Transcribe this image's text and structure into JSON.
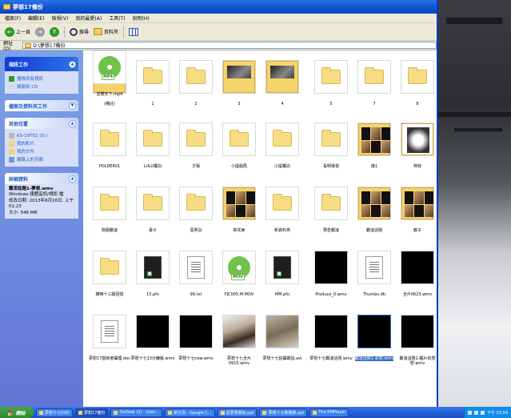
{
  "window": {
    "title": "夢想17備份",
    "menu": [
      "檔案(F)",
      "編輯(E)",
      "檢視(V)",
      "我的最愛(A)",
      "工具(T)",
      "說明(H)"
    ],
    "toolbar": {
      "back": "上一頁",
      "search": "搜尋",
      "folders": "資料夾"
    },
    "address_label": "網址(D)",
    "address_value": "D:\\夢想17備份"
  },
  "taskpane": {
    "video_tasks": {
      "title": "視訊工作",
      "items": [
        "播放所有視訊",
        "燒製到 CD"
      ]
    },
    "file_tasks": {
      "title": "檔案及資料夾工作"
    },
    "other_places": {
      "title": "其他位置",
      "items": [
        "KS-19T02 (D:)",
        "我的影片",
        "我的文件",
        "網路上的芳鄰"
      ]
    },
    "details": {
      "title": "詳細資料",
      "name": "霸凌話題1-夢想.wmv",
      "type": "Windows 媒體音訊/視訊 檔",
      "modified": "修改日期: 2013年8月16日, 上午 01:23",
      "size": "大小: 546 MB"
    }
  },
  "files": [
    {
      "label": "(備註)",
      "kind": "folder-preview"
    },
    {
      "label": "1",
      "kind": "folder"
    },
    {
      "label": "2",
      "kind": "folder"
    },
    {
      "label": "3",
      "kind": "folder-photo"
    },
    {
      "label": "4",
      "kind": "folder-photo"
    },
    {
      "label": "5",
      "kind": "folder"
    },
    {
      "label": "7",
      "kind": "folder"
    },
    {
      "label": "8",
      "kind": "folder"
    },
    {
      "label": "POLDER01",
      "kind": "folder"
    },
    {
      "label": "LULU獨白",
      "kind": "folder"
    },
    {
      "label": "夕陽",
      "kind": "folder"
    },
    {
      "label": "小提組局",
      "kind": "folder"
    },
    {
      "label": "小提獨白",
      "kind": "folder"
    },
    {
      "label": "長明電視",
      "kind": "folder"
    },
    {
      "label": "綠1",
      "kind": "folder-grid"
    },
    {
      "label": "特效",
      "kind": "folder-sketch"
    },
    {
      "label": "院服霸凌",
      "kind": "folder"
    },
    {
      "label": "妻子",
      "kind": "folder"
    },
    {
      "label": "惡男白",
      "kind": "folder"
    },
    {
      "label": "新花束",
      "kind": "folder-grid"
    },
    {
      "label": "新資料夾",
      "kind": "folder"
    },
    {
      "label": "預告霸凌",
      "kind": "folder"
    },
    {
      "label": "霸凌話題",
      "kind": "folder-grid"
    },
    {
      "label": "鏡子",
      "kind": "folder-grid"
    },
    {
      "label": "襪時十三級回憶",
      "kind": "folder"
    },
    {
      "label": "15.pfo",
      "kind": "doc-dark"
    },
    {
      "label": "99.txt",
      "kind": "doc"
    },
    {
      "label": "FJC005.M.MOV",
      "kind": "mov"
    },
    {
      "label": "MM.pfo",
      "kind": "doc-dark"
    },
    {
      "label": "Produce_0.wmv",
      "kind": "video"
    },
    {
      "label": "Thumbs.db",
      "kind": "doc"
    },
    {
      "label": "全片0623.wmv",
      "kind": "video"
    },
    {
      "label": "夢想17首映會攝理.doc",
      "kind": "doc"
    },
    {
      "label": "夢想十七13分鐘版.wmv",
      "kind": "video"
    },
    {
      "label": "夢想十七new.wmv",
      "kind": "video"
    },
    {
      "label": "夢想十七全片0915.wmv",
      "kind": "photo"
    },
    {
      "label": "夢想十七拍攝期話.avi",
      "kind": "photo2"
    },
    {
      "label": "夢想十七霸凌話題.wmv",
      "kind": "video"
    },
    {
      "label": "霸凌話題1-夢想.wmv",
      "kind": "video",
      "selected": true
    },
    {
      "label": "霸凌話題1-睡片的感想.wmv",
      "kind": "video"
    },
    {
      "label": "逆轉天下.mp4",
      "kind": "mp4"
    }
  ],
  "taskbar": {
    "start": "開始",
    "tasks": [
      "夢想十七DVD",
      "夢想17備份",
      "Outlook (1) - clien...",
      "新分頁 - Google C...",
      "從夢想開始.ppt",
      "夢想十七致敬辭.ppt",
      "The KMPlayer"
    ],
    "time": "下午 03:54"
  }
}
